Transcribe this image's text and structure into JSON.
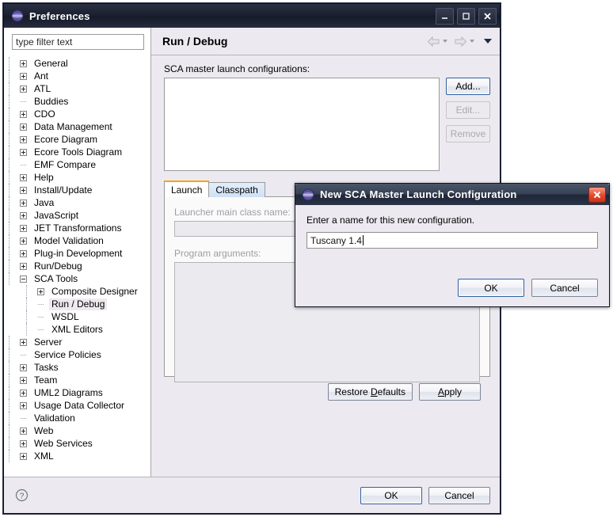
{
  "window": {
    "title": "Preferences",
    "icon": "eclipse-globe-icon",
    "controls": {
      "minimize": "minimize-icon",
      "maximize": "maximize-icon",
      "close": "close-icon"
    }
  },
  "filter": {
    "placeholder": "type filter text",
    "value": ""
  },
  "tree": {
    "items": [
      {
        "label": "General",
        "state": "collapsed",
        "level": 0
      },
      {
        "label": "Ant",
        "state": "collapsed",
        "level": 0
      },
      {
        "label": "ATL",
        "state": "collapsed",
        "level": 0
      },
      {
        "label": "Buddies",
        "state": "leaf",
        "level": 0
      },
      {
        "label": "CDO",
        "state": "collapsed",
        "level": 0
      },
      {
        "label": "Data Management",
        "state": "collapsed",
        "level": 0
      },
      {
        "label": "Ecore Diagram",
        "state": "collapsed",
        "level": 0
      },
      {
        "label": "Ecore Tools Diagram",
        "state": "collapsed",
        "level": 0
      },
      {
        "label": "EMF Compare",
        "state": "leaf",
        "level": 0
      },
      {
        "label": "Help",
        "state": "collapsed",
        "level": 0
      },
      {
        "label": "Install/Update",
        "state": "collapsed",
        "level": 0
      },
      {
        "label": "Java",
        "state": "collapsed",
        "level": 0
      },
      {
        "label": "JavaScript",
        "state": "collapsed",
        "level": 0
      },
      {
        "label": "JET Transformations",
        "state": "collapsed",
        "level": 0
      },
      {
        "label": "Model Validation",
        "state": "collapsed",
        "level": 0
      },
      {
        "label": "Plug-in Development",
        "state": "collapsed",
        "level": 0
      },
      {
        "label": "Run/Debug",
        "state": "collapsed",
        "level": 0
      },
      {
        "label": "SCA Tools",
        "state": "expanded",
        "level": 0
      },
      {
        "label": "Composite Designer",
        "state": "collapsed",
        "level": 1
      },
      {
        "label": "Run / Debug",
        "state": "leaf",
        "level": 1,
        "selected": true
      },
      {
        "label": "WSDL",
        "state": "leaf",
        "level": 1
      },
      {
        "label": "XML Editors",
        "state": "leaf",
        "level": 1
      },
      {
        "label": "Server",
        "state": "collapsed",
        "level": 0
      },
      {
        "label": "Service Policies",
        "state": "leaf",
        "level": 0
      },
      {
        "label": "Tasks",
        "state": "collapsed",
        "level": 0
      },
      {
        "label": "Team",
        "state": "collapsed",
        "level": 0
      },
      {
        "label": "UML2 Diagrams",
        "state": "collapsed",
        "level": 0
      },
      {
        "label": "Usage Data Collector",
        "state": "collapsed",
        "level": 0
      },
      {
        "label": "Validation",
        "state": "leaf",
        "level": 0
      },
      {
        "label": "Web",
        "state": "collapsed",
        "level": 0
      },
      {
        "label": "Web Services",
        "state": "collapsed",
        "level": 0
      },
      {
        "label": "XML",
        "state": "collapsed",
        "level": 0
      }
    ]
  },
  "page": {
    "title": "Run / Debug",
    "nav": {
      "back": "back-arrow-icon",
      "forward": "forward-arrow-icon",
      "menu": "view-menu-icon"
    },
    "list_label": "SCA master launch configurations:",
    "list_items": [],
    "side_buttons": [
      {
        "label": "Add...",
        "enabled": true,
        "focused": true
      },
      {
        "label": "Edit...",
        "enabled": false,
        "focused": false
      },
      {
        "label": "Remove",
        "enabled": false,
        "focused": false
      }
    ],
    "tabs": [
      {
        "label": "Launch",
        "active": true
      },
      {
        "label": "Classpath",
        "active": false
      }
    ],
    "launcher_label": "Launcher main class name:",
    "launcher_value": "",
    "program_args_label": "Program arguments:",
    "program_args_value": "",
    "restore_defaults_label": "Restore Defaults",
    "restore_defaults_mnemonic": "D",
    "apply_label": "Apply",
    "apply_mnemonic": "A"
  },
  "footer": {
    "help": "help-icon",
    "ok_label": "OK",
    "cancel_label": "Cancel"
  },
  "dialog": {
    "icon": "eclipse-globe-icon",
    "title": "New SCA Master Launch Configuration",
    "close": "close-icon",
    "prompt": "Enter a name for this new configuration.",
    "input_value": "Tuscany 1.4",
    "ok_label": "OK",
    "cancel_label": "Cancel"
  },
  "colors": {
    "titlebar_dark": "#1a2030",
    "dialog_titlebar": "#394357",
    "accent_tab": "#f7a50a",
    "focus_border": "#2e5f9e",
    "close_red": "#e8472a",
    "window_bg": "#ece9f0",
    "selection_bg": "#ede9ee"
  }
}
